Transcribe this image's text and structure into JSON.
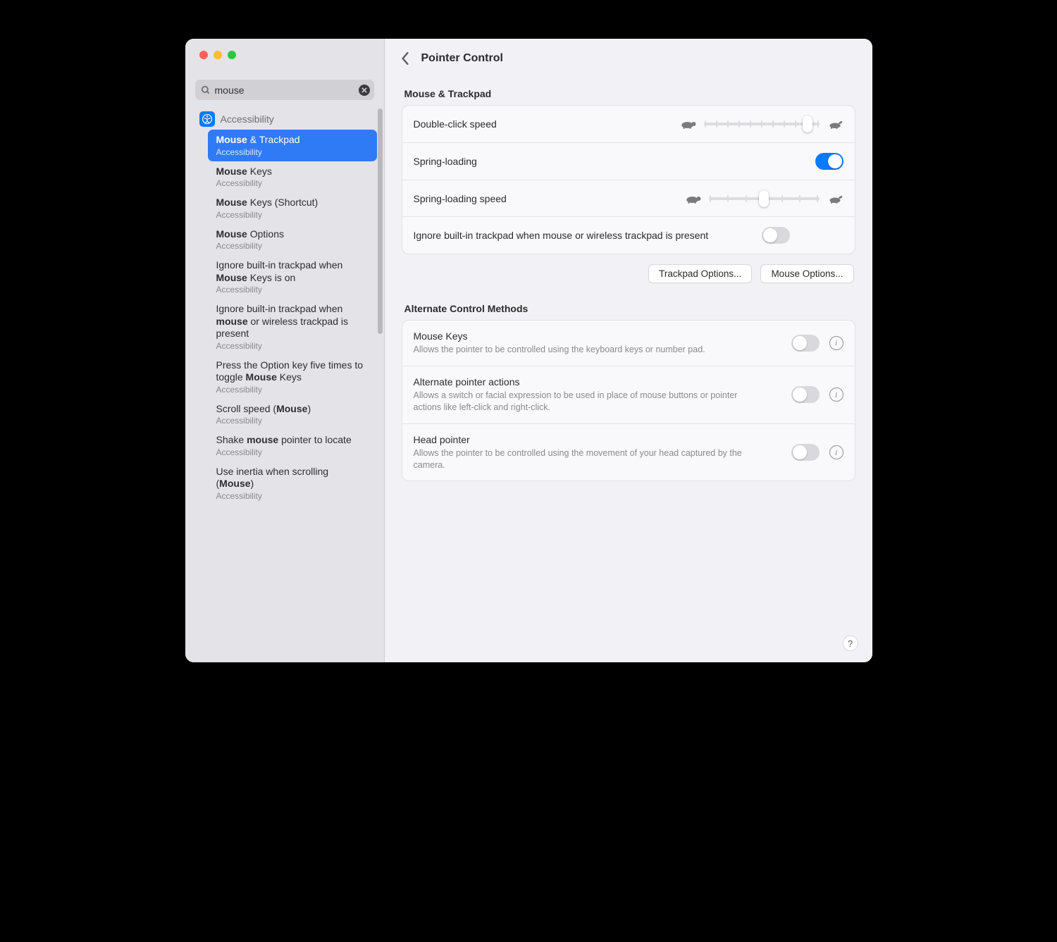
{
  "search": {
    "value": "mouse"
  },
  "sidebar_parent": {
    "label": "Accessibility"
  },
  "header": {
    "title": "Pointer Control"
  },
  "results": [
    {
      "title_html": "<b>Mouse</b> & Trackpad",
      "sub": "Accessibility",
      "selected": true
    },
    {
      "title_html": "<b>Mouse</b> Keys",
      "sub": "Accessibility"
    },
    {
      "title_html": "<b>Mouse</b> Keys (Shortcut)",
      "sub": "Accessibility"
    },
    {
      "title_html": "<b>Mouse</b> Options",
      "sub": "Accessibility"
    },
    {
      "title_html": "Ignore built-in trackpad when <b>Mouse</b> Keys is on",
      "sub": "Accessibility"
    },
    {
      "title_html": "Ignore built-in trackpad when <b>mouse</b> or wireless trackpad is present",
      "sub": "Accessibility"
    },
    {
      "title_html": "Press the Option key five times to toggle <b>Mouse</b> Keys",
      "sub": "Accessibility"
    },
    {
      "title_html": "Scroll speed (<b>Mouse</b>)",
      "sub": "Accessibility"
    },
    {
      "title_html": "Shake <b>mouse</b> pointer to locate",
      "sub": "Accessibility"
    },
    {
      "title_html": "Use inertia when scrolling (<b>Mouse</b>)",
      "sub": "Accessibility"
    }
  ],
  "sections": {
    "mouse_trackpad": {
      "title": "Mouse & Trackpad",
      "double_click_label": "Double-click speed",
      "double_click_value": 90,
      "double_click_ticks": 11,
      "spring_loading_label": "Spring-loading",
      "spring_loading_on": true,
      "spring_speed_label": "Spring-loading speed",
      "spring_speed_value": 50,
      "spring_speed_ticks": 7,
      "ignore_trackpad_label": "Ignore built-in trackpad when mouse or wireless trackpad is present",
      "ignore_trackpad_on": false,
      "trackpad_options_btn": "Trackpad Options...",
      "mouse_options_btn": "Mouse Options..."
    },
    "alternate": {
      "title": "Alternate Control Methods",
      "items": [
        {
          "title": "Mouse Keys",
          "desc": "Allows the pointer to be controlled using the keyboard keys or number pad.",
          "on": false
        },
        {
          "title": "Alternate pointer actions",
          "desc": "Allows a switch or facial expression to be used in place of mouse buttons or pointer actions like left-click and right-click.",
          "on": false
        },
        {
          "title": "Head pointer",
          "desc": "Allows the pointer to be controlled using the movement of your head captured by the camera.",
          "on": false
        }
      ]
    }
  },
  "help": "?"
}
